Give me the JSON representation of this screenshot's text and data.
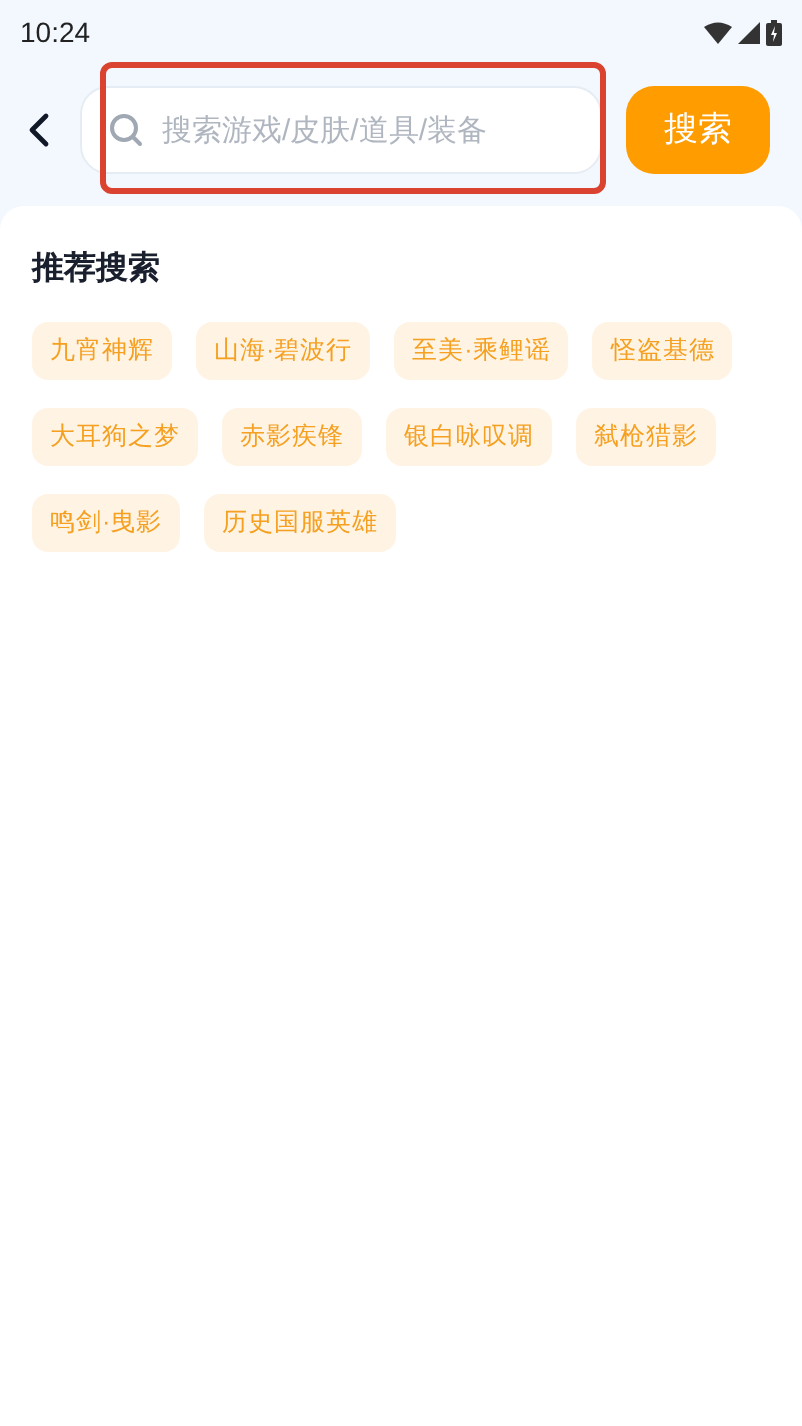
{
  "status_bar": {
    "time": "10:24"
  },
  "search": {
    "placeholder": "搜索游戏/皮肤/道具/装备",
    "button": "搜索"
  },
  "recommended": {
    "title": "推荐搜索",
    "tags": [
      "九宵神辉",
      "山海·碧波行",
      "至美·乘鲤谣",
      "怪盗基德",
      "大耳狗之梦",
      "赤影疾锋",
      "银白咏叹调",
      "弑枪猎影",
      "鸣剑·曳影",
      "历史国服英雄"
    ]
  }
}
